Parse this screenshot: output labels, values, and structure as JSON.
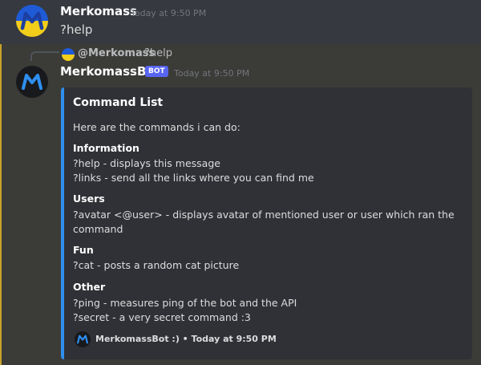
{
  "message1": {
    "username": "Merkomass",
    "timestamp": "Today at 9:50 PM",
    "content": "?help"
  },
  "message2": {
    "reply": {
      "username": "@Merkomass",
      "text": "?help"
    },
    "username": "MerkomassBot",
    "badge": "BOT",
    "timestamp": "Today at 9:50 PM",
    "embed": {
      "accent_color": "#2f8ff0",
      "title": "Command List",
      "description": "Here are the commands i can do:",
      "fields": [
        {
          "name": "Information",
          "lines": [
            "?help - displays this message",
            "?links - send all the links where you can find me"
          ]
        },
        {
          "name": "Users",
          "lines": [
            "?avatar <@user> - displays avatar of mentioned user or user which ran the",
            "command"
          ]
        },
        {
          "name": "Fun",
          "lines": [
            "?cat - posts a random cat picture"
          ]
        },
        {
          "name": "Other",
          "lines": [
            "?ping - measures ping of the bot and the API",
            "?secret - a very secret command :3"
          ]
        }
      ],
      "footer": {
        "text": "MerkomassBot :) • Today at 9:50 PM"
      }
    }
  },
  "colors": {
    "background": "#36393f",
    "highlight_bg": "#3b3b38",
    "mention_bar": "#c9a227",
    "bot_badge": "#5865f2",
    "flag_blue": "#1f5bd6",
    "flag_yellow": "#f2cd1a"
  },
  "icons": {
    "user_avatar": "merkomass-avatar-icon",
    "bot_avatar": "merkomassbot-avatar-icon"
  }
}
